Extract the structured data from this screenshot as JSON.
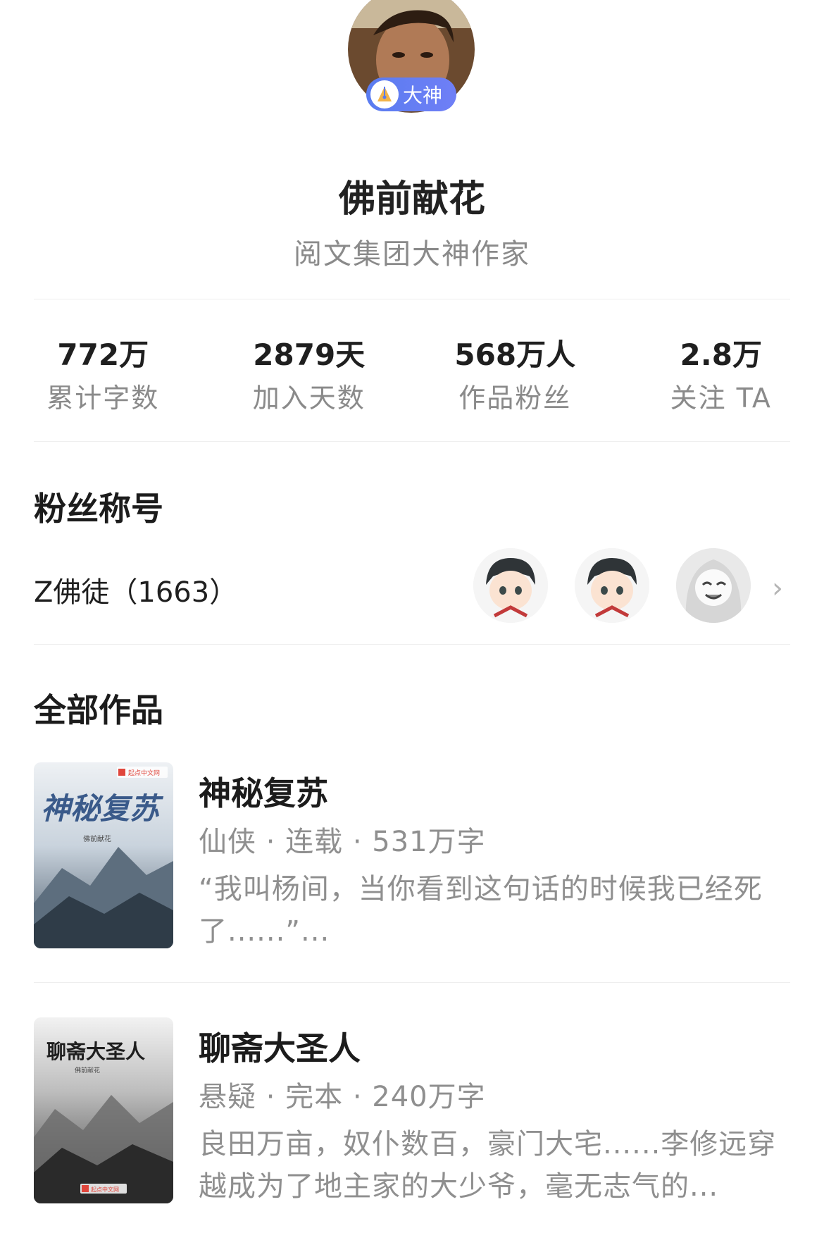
{
  "profile": {
    "badge_label": "大神",
    "name": "佛前献花",
    "subtitle": "阅文集团大神作家"
  },
  "stats": [
    {
      "value": "772万",
      "label": "累计字数"
    },
    {
      "value": "2879天",
      "label": "加入天数"
    },
    {
      "value": "568万人",
      "label": "作品粉丝"
    },
    {
      "value": "2.8万",
      "label": "关注 TA"
    }
  ],
  "fans": {
    "section_title": "粉丝称号",
    "title_name": "Z佛徒（1663）",
    "chevron": "›"
  },
  "works": {
    "section_title": "全部作品",
    "books": [
      {
        "title": "神秘复苏",
        "meta": "仙侠 · 连载 · 531万字",
        "desc": "“我叫杨间，当你看到这句话的时候我已经死了......”...",
        "cover_title": "神秘复苏",
        "cover_author": "佛前献花",
        "cover_logo": "起点中文网"
      },
      {
        "title": "聊斋大圣人",
        "meta": "悬疑 · 完本 · 240万字",
        "desc": "良田万亩，奴仆数百，豪门大宅......李修远穿越成为了地主家的大少爷，毫无志气的...",
        "cover_title": "聊斋大圣人",
        "cover_author": "佛前献花",
        "cover_logo": "起点中文网"
      }
    ]
  },
  "colors": {
    "badge": "#5a7cf0",
    "text_primary": "#1c1c1c",
    "text_secondary": "#8f8f8f",
    "divider": "#eeeeee"
  }
}
